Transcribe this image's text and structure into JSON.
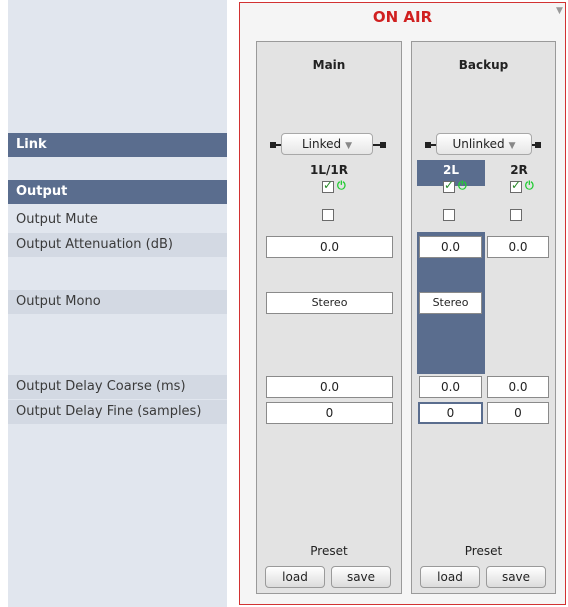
{
  "left_labels": {
    "link": "Link",
    "output": "Output",
    "output_mute": "Output Mute",
    "output_attenuation": "Output Attenuation (dB)",
    "output_mono": "Output Mono",
    "output_delay_coarse": "Output Delay Coarse (ms)",
    "output_delay_fine": "Output Delay Fine (samples)"
  },
  "panel": {
    "status": "ON AIR",
    "main": {
      "title": "Main",
      "link_mode": "Linked",
      "channel": "1L/1R",
      "enabled": true,
      "mute": false,
      "attenuation": "0.0",
      "mono": "Stereo",
      "delay_coarse": "0.0",
      "delay_fine": "0",
      "preset_label": "Preset",
      "load": "load",
      "save": "save"
    },
    "backup": {
      "title": "Backup",
      "link_mode": "Unlinked",
      "channels": [
        {
          "name": "2L",
          "enabled": true,
          "mute": false,
          "attenuation": "0.0",
          "mono": "Stereo",
          "delay_coarse": "0.0",
          "delay_fine": "0"
        },
        {
          "name": "2R",
          "enabled": true,
          "mute": false,
          "attenuation": "0.0",
          "delay_coarse": "0.0",
          "delay_fine": "0"
        }
      ],
      "preset_label": "Preset",
      "load": "load",
      "save": "save"
    }
  },
  "icons": {
    "power": "power-icon",
    "dropdown": "chevron-down-icon",
    "corner": "triangle-down-icon"
  },
  "colors": {
    "header_bg": "#5a6d8e",
    "on_air": "#d02020",
    "power_green": "#22cc33"
  }
}
